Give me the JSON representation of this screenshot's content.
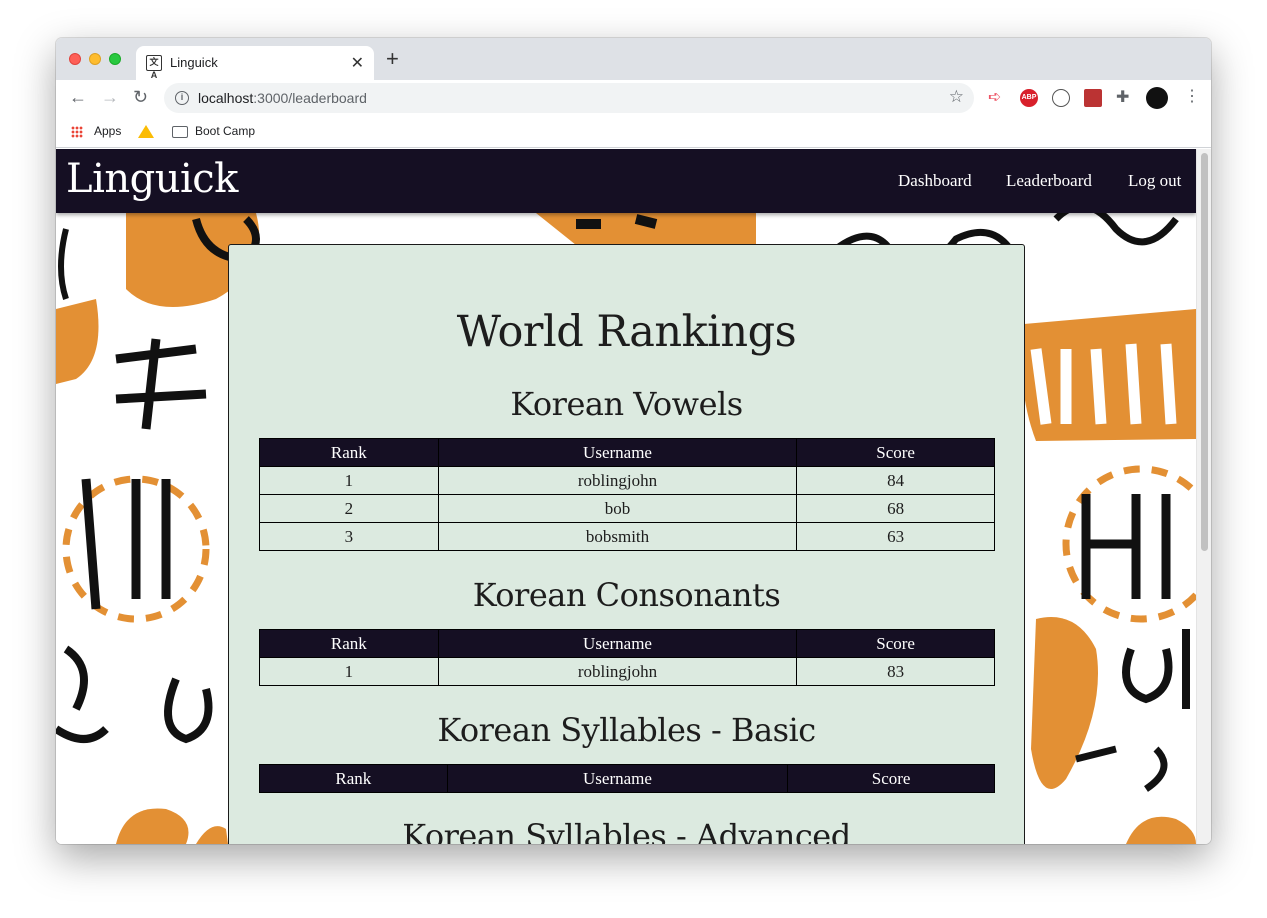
{
  "browser": {
    "tab_title": "Linguick",
    "favicon_text": "文A",
    "url_host": "localhost",
    "url_rest": ":3000/leaderboard",
    "bookmarks": [
      "Apps",
      "Boot Camp"
    ]
  },
  "site": {
    "brand": "Linguick",
    "nav": [
      "Dashboard",
      "Leaderboard",
      "Log out"
    ]
  },
  "page": {
    "title": "World Rankings",
    "columns": [
      "Rank",
      "Username",
      "Score"
    ],
    "sections": [
      {
        "title": "Korean Vowels",
        "rows": [
          [
            "1",
            "roblingjohn",
            "84"
          ],
          [
            "2",
            "bob",
            "68"
          ],
          [
            "3",
            "bobsmith",
            "63"
          ]
        ]
      },
      {
        "title": "Korean Consonants",
        "rows": [
          [
            "1",
            "roblingjohn",
            "83"
          ]
        ]
      },
      {
        "title": "Korean Syllables - Basic",
        "rows": []
      },
      {
        "title": "Korean Syllables - Advanced",
        "rows": []
      }
    ]
  },
  "colors": {
    "navbar": "#150f23",
    "card": "#dceae0",
    "art_orange": "#e39034"
  }
}
